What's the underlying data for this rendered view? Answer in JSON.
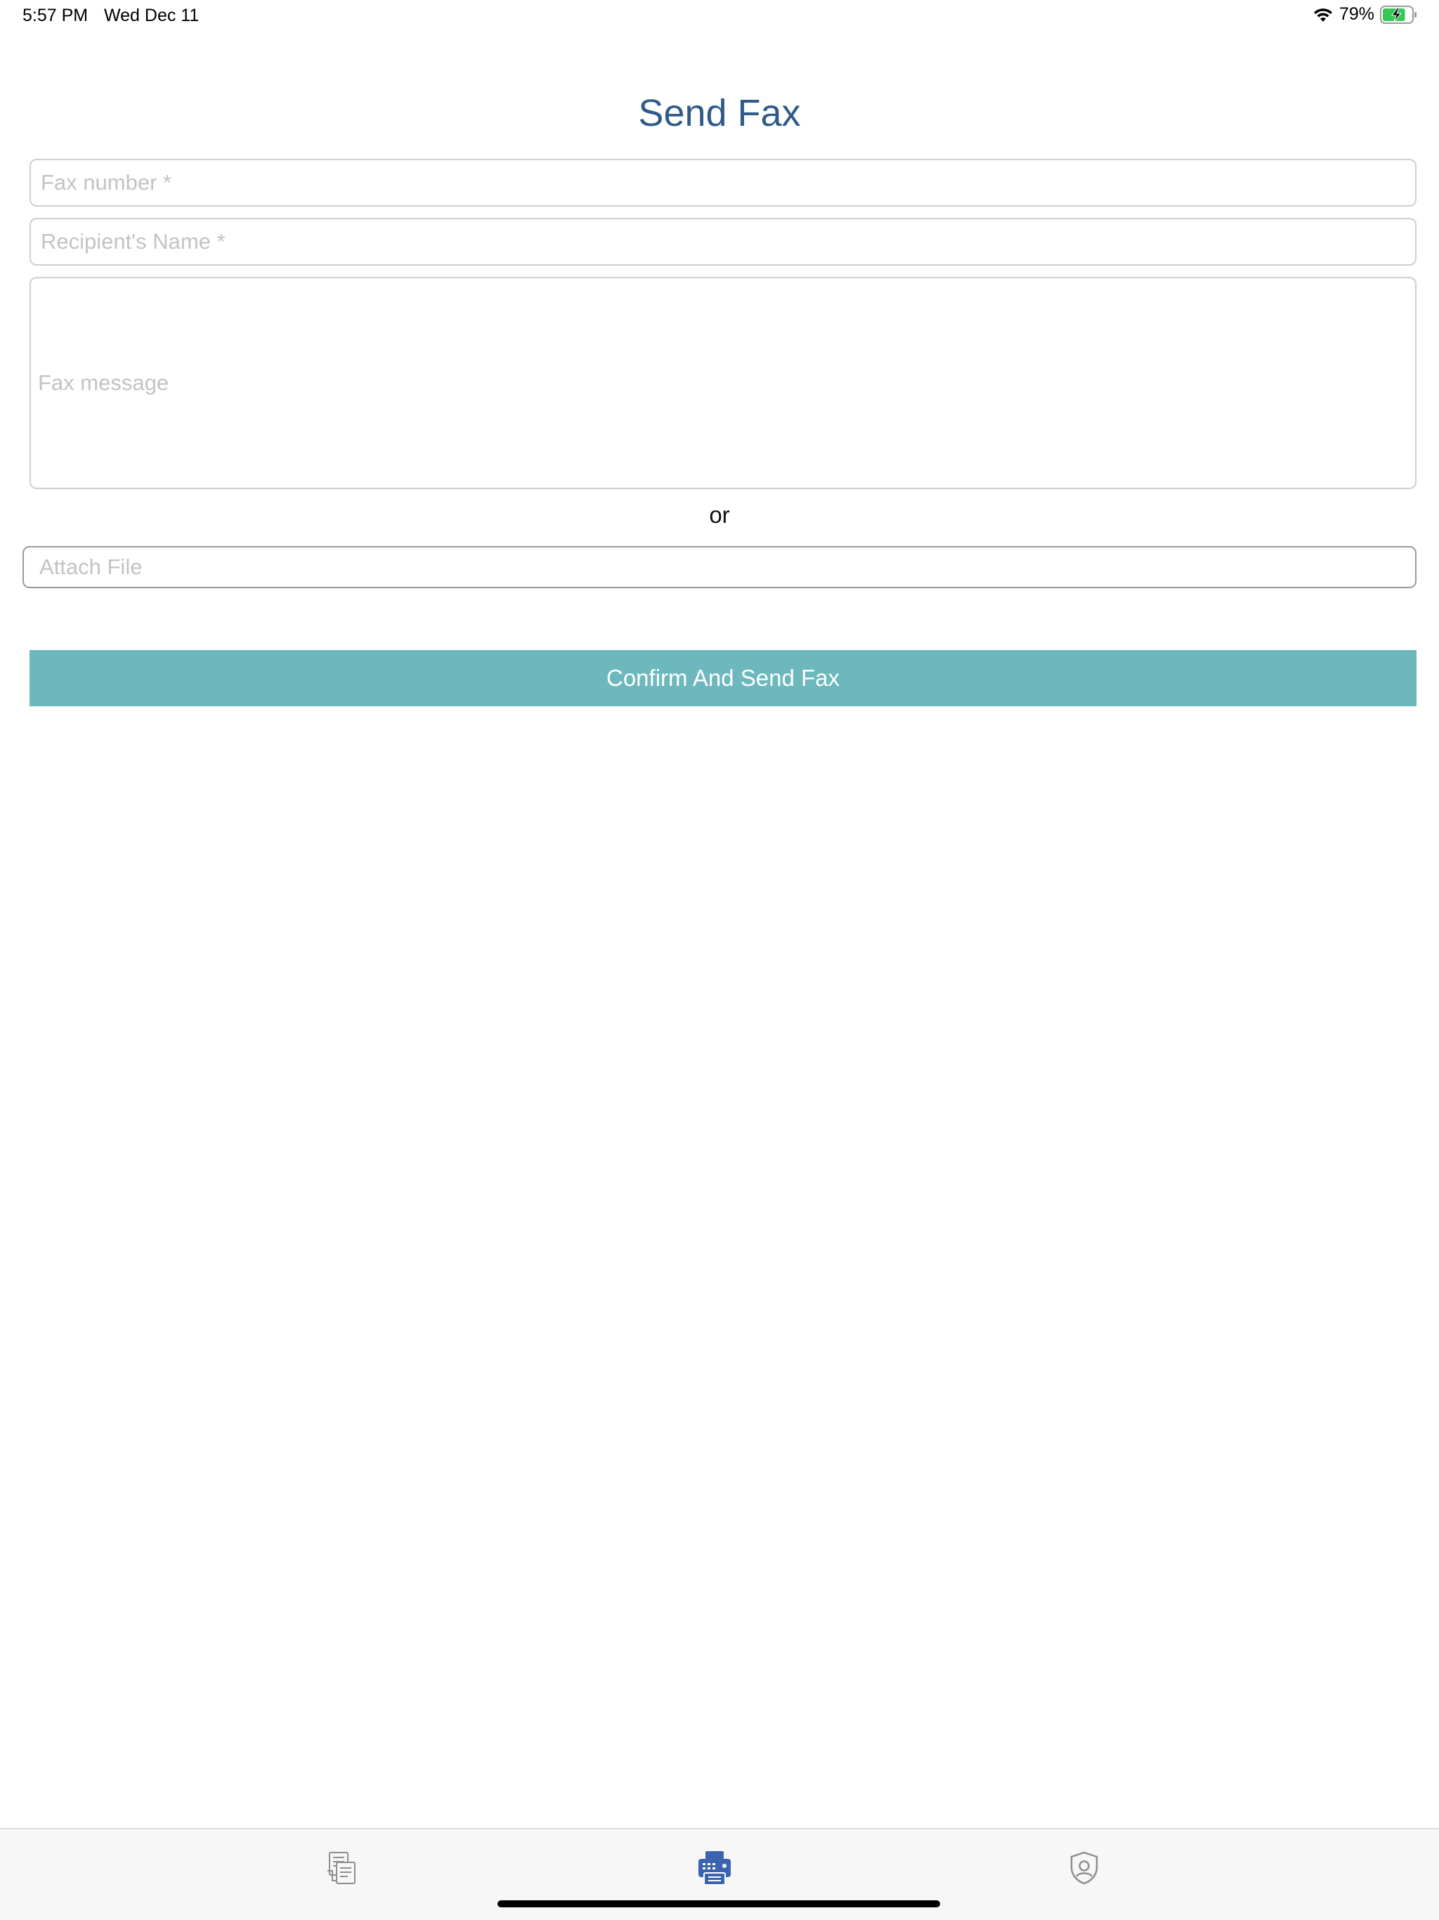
{
  "status_bar": {
    "time": "5:57 PM",
    "date": "Wed Dec 11",
    "battery_percent": "79%",
    "battery_level": 0.79,
    "icons": [
      "wifi-icon",
      "battery-charging-icon"
    ]
  },
  "page": {
    "title": "Send Fax"
  },
  "form": {
    "fax_number_placeholder": "Fax number *",
    "recipient_name_placeholder": "Recipient's Name *",
    "fax_message_placeholder": "Fax message",
    "or_label": "or",
    "attach_file_placeholder": "Attach File",
    "confirm_label": "Confirm And Send Fax"
  },
  "tab_bar": {
    "tabs": [
      {
        "icon": "documents-icon",
        "active": false
      },
      {
        "icon": "fax-machine-icon",
        "active": true
      },
      {
        "icon": "shield-user-icon",
        "active": false
      }
    ]
  },
  "colors": {
    "title": "#2e5b8a",
    "button": "#6cb8bd",
    "active_tab": "#3a64b0",
    "inactive_tab": "#8e8e93"
  }
}
